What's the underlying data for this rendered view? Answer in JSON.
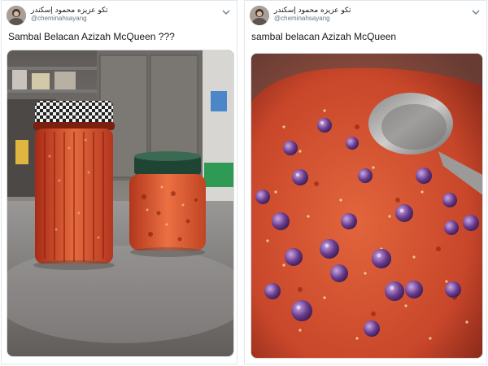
{
  "left_tweet": {
    "display_name": "تكو عزيزه محمود إسكندر",
    "handle": "@cheminahsayang",
    "text": "Sambal Belacan Azizah McQueen ???",
    "avatar_icon": "profile-photo",
    "menu_icon": "chevron-down-icon",
    "photo": "two-jars-of-chili-sambal"
  },
  "right_tweet": {
    "display_name": "تكو عزيزه محمود إسكندر",
    "handle": "@cheminahsayang",
    "text": "sambal belacan Azizah McQueen",
    "avatar_icon": "profile-photo",
    "menu_icon": "chevron-down-icon",
    "photo": "pot-of-chili-sambal-with-shallots"
  },
  "colors": {
    "text": "#14171a",
    "muted": "#657786",
    "border": "#e3e6e8",
    "sambal": "#c9492a",
    "shallot": "#6a3c8c"
  }
}
